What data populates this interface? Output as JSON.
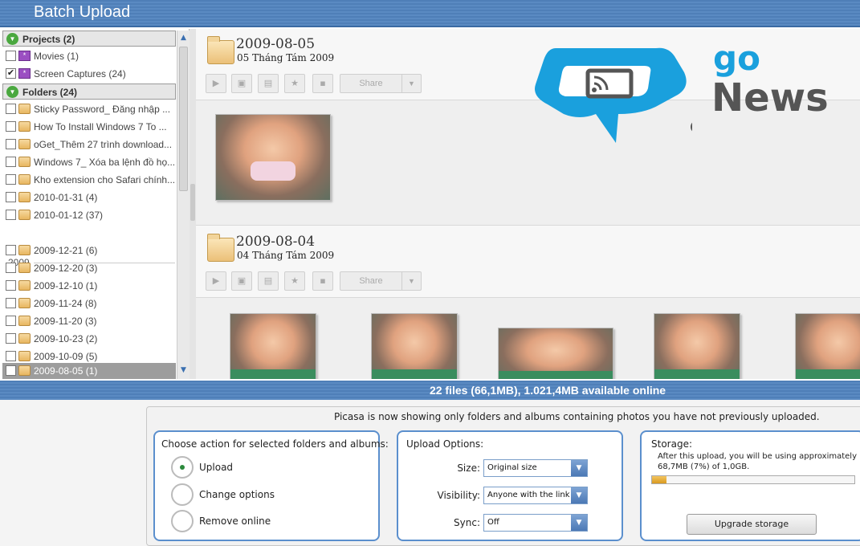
{
  "app": {
    "title": "Batch Upload"
  },
  "sidebar": {
    "projects_header": "Projects (2)",
    "projects": [
      {
        "label": "Movies (1)",
        "checked": false,
        "icon": "movie-icon"
      },
      {
        "label": "Screen Captures (24)",
        "checked": true,
        "icon": "movie-icon"
      }
    ],
    "folders_header": "Folders (24)",
    "folders": [
      {
        "label": "Sticky Password_ Đăng nhập ..."
      },
      {
        "label": "How To Install Windows 7 To ..."
      },
      {
        "label": "oGet_Thêm 27 trình download..."
      },
      {
        "label": "Windows 7_ Xóa ba lệnh đồ họ..."
      },
      {
        "label": "Kho extension cho Safari chính..."
      },
      {
        "label": "2010-01-31 (4)"
      },
      {
        "label": "2010-01-12 (37)"
      }
    ],
    "year_label": "2009",
    "folders_2009": [
      {
        "label": "2009-12-21 (6)"
      },
      {
        "label": "2009-12-20 (3)"
      },
      {
        "label": "2009-12-10 (1)"
      },
      {
        "label": "2009-11-24 (8)"
      },
      {
        "label": "2009-11-20 (3)"
      },
      {
        "label": "2009-10-23 (2)"
      },
      {
        "label": "2009-10-09 (5)"
      },
      {
        "label": "2009-08-05 (1)",
        "selected": true
      }
    ]
  },
  "main": {
    "sections": [
      {
        "title": "2009-08-05",
        "subtitle": "05 Tháng Tám 2009",
        "share_label": "Share"
      },
      {
        "title": "2009-08-04",
        "subtitle": "04 Tháng Tám 2009",
        "share_label": "Share"
      }
    ],
    "logo": {
      "go": "go",
      "news": "News"
    }
  },
  "status": {
    "text": "22 files (66,1MB), 1.021,4MB available online"
  },
  "bottom": {
    "notice": "Picasa is now showing only folders and albums containing photos you have not previously uploaded.",
    "action": {
      "header": "Choose action for selected folders and albums:",
      "options": [
        "Upload",
        "Change options",
        "Remove online"
      ],
      "selected": "Upload"
    },
    "upload_options": {
      "header": "Upload Options:",
      "size_label": "Size:",
      "size_value": "Original size",
      "visibility_label": "Visibility:",
      "visibility_value": "Anyone with the link",
      "sync_label": "Sync:",
      "sync_value": "Off"
    },
    "storage": {
      "header": "Storage:",
      "text": "After this upload, you will be using approximately 68,7MB (7%) of 1,0GB.",
      "used_fraction": 0.07,
      "button_label": "Upgrade storage"
    }
  },
  "colors": {
    "accent": "#5b8fcd",
    "titlebar": "#4f7fb8",
    "check_green": "#4aa83f",
    "logo_blue": "#1aa0dd"
  }
}
